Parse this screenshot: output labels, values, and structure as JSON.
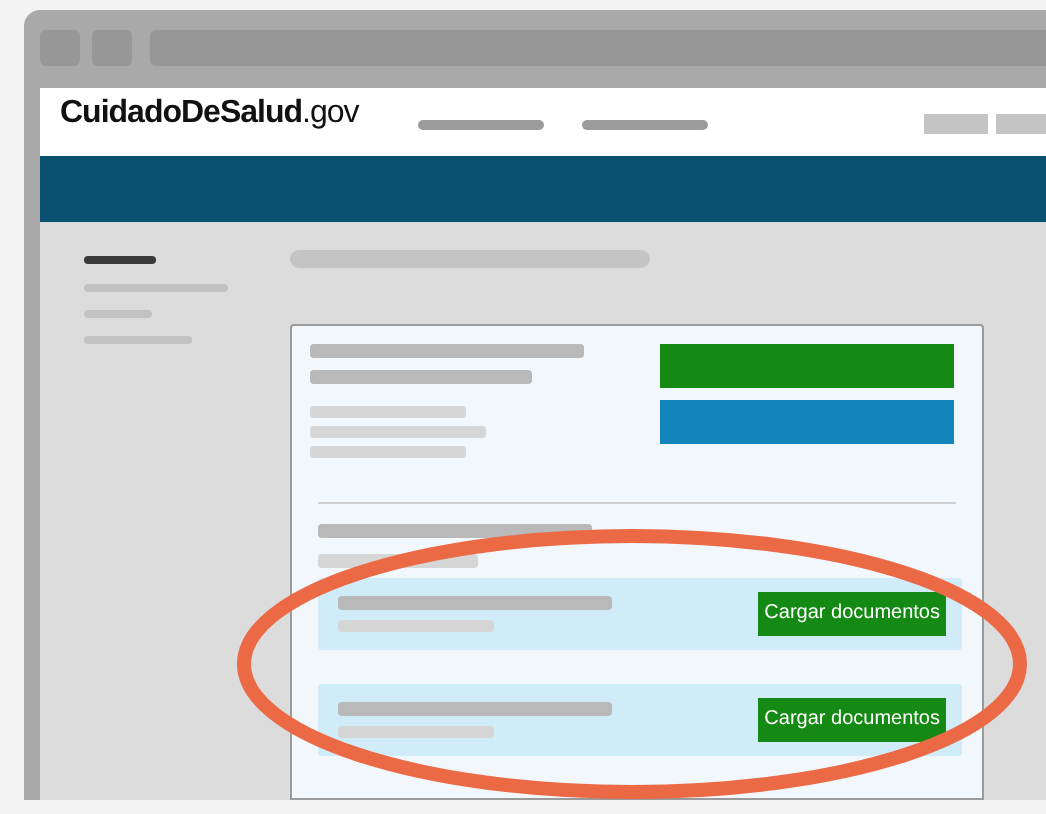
{
  "site": {
    "logo": "**CuidadoDeSalud**.gov"
  },
  "documents": [
    {
      "button": "Cargar documentos"
    },
    {
      "button": "Cargar documentos"
    }
  ]
}
